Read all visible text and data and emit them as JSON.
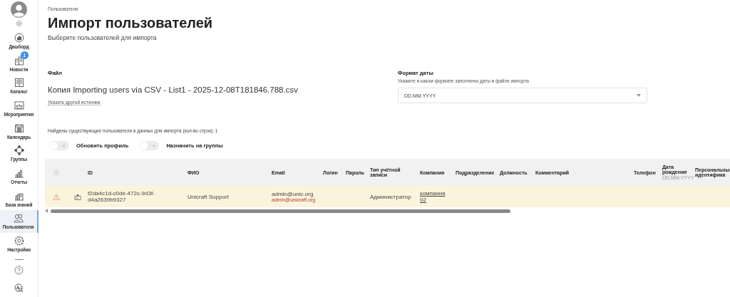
{
  "sidebar": {
    "items": [
      {
        "label": "Дашборд",
        "selected": false
      },
      {
        "label": "Новости",
        "selected": false,
        "badge": "1"
      },
      {
        "label": "Каталог",
        "selected": false
      },
      {
        "label": "Мероприятия",
        "selected": false
      },
      {
        "label": "Календарь",
        "selected": false
      },
      {
        "label": "Группы",
        "selected": false
      },
      {
        "label": "Отчеты",
        "selected": false
      },
      {
        "label": "База знаний",
        "selected": false
      },
      {
        "label": "Пользователи",
        "selected": true
      },
      {
        "label": "Настройки",
        "selected": false
      }
    ]
  },
  "breadcrumb": "Пользователи",
  "title": "Импорт пользователей",
  "subtitle": "Выберите пользователей для импорта",
  "file": {
    "label": "Файл",
    "name": "Копия Importing users via CSV - List1 - 2025-12-08T181846.788.csv",
    "link": "Указать другой источник"
  },
  "date_format": {
    "label": "Формат даты",
    "hint": "Укажите в каком формате заполнены даты в файле импорта",
    "value": "DD.MM.YYYY"
  },
  "found_note": "Найдены существующие пользователи в данных для импорта (кол-во строк): 1",
  "toggles": [
    {
      "label": "Обновить профиль",
      "on": false,
      "off_glyph": "×"
    },
    {
      "label": "Назначить на группы",
      "on": false,
      "off_glyph": "×"
    }
  ],
  "table": {
    "select_all": {
      "checked": false
    },
    "columns": [
      {
        "label": "ID"
      },
      {
        "label": "ФИО"
      },
      {
        "label": "Email"
      },
      {
        "label": "Логин"
      },
      {
        "label": "Пароль"
      },
      {
        "label": "Тип учётной записи"
      },
      {
        "label": "Компания"
      },
      {
        "label": "Подразделение"
      },
      {
        "label": "Должность"
      },
      {
        "label": "Комментарий"
      },
      {
        "label": "Телефон"
      },
      {
        "label": "Дата рождения",
        "hint": "DD.MM.YYYY"
      },
      {
        "label": "Персональны идентифика"
      }
    ],
    "rows": [
      {
        "warning": true,
        "cells": [
          "f2da4c1d-c0de-472c-9d3f-d4a2639b9327",
          "Unicraft Support",
          "admin@unic.org",
          "",
          "",
          "Администратор",
          "компания 02",
          "",
          "",
          "",
          "",
          "",
          ""
        ],
        "email_existing": "admin@unicraft.org"
      }
    ]
  }
}
